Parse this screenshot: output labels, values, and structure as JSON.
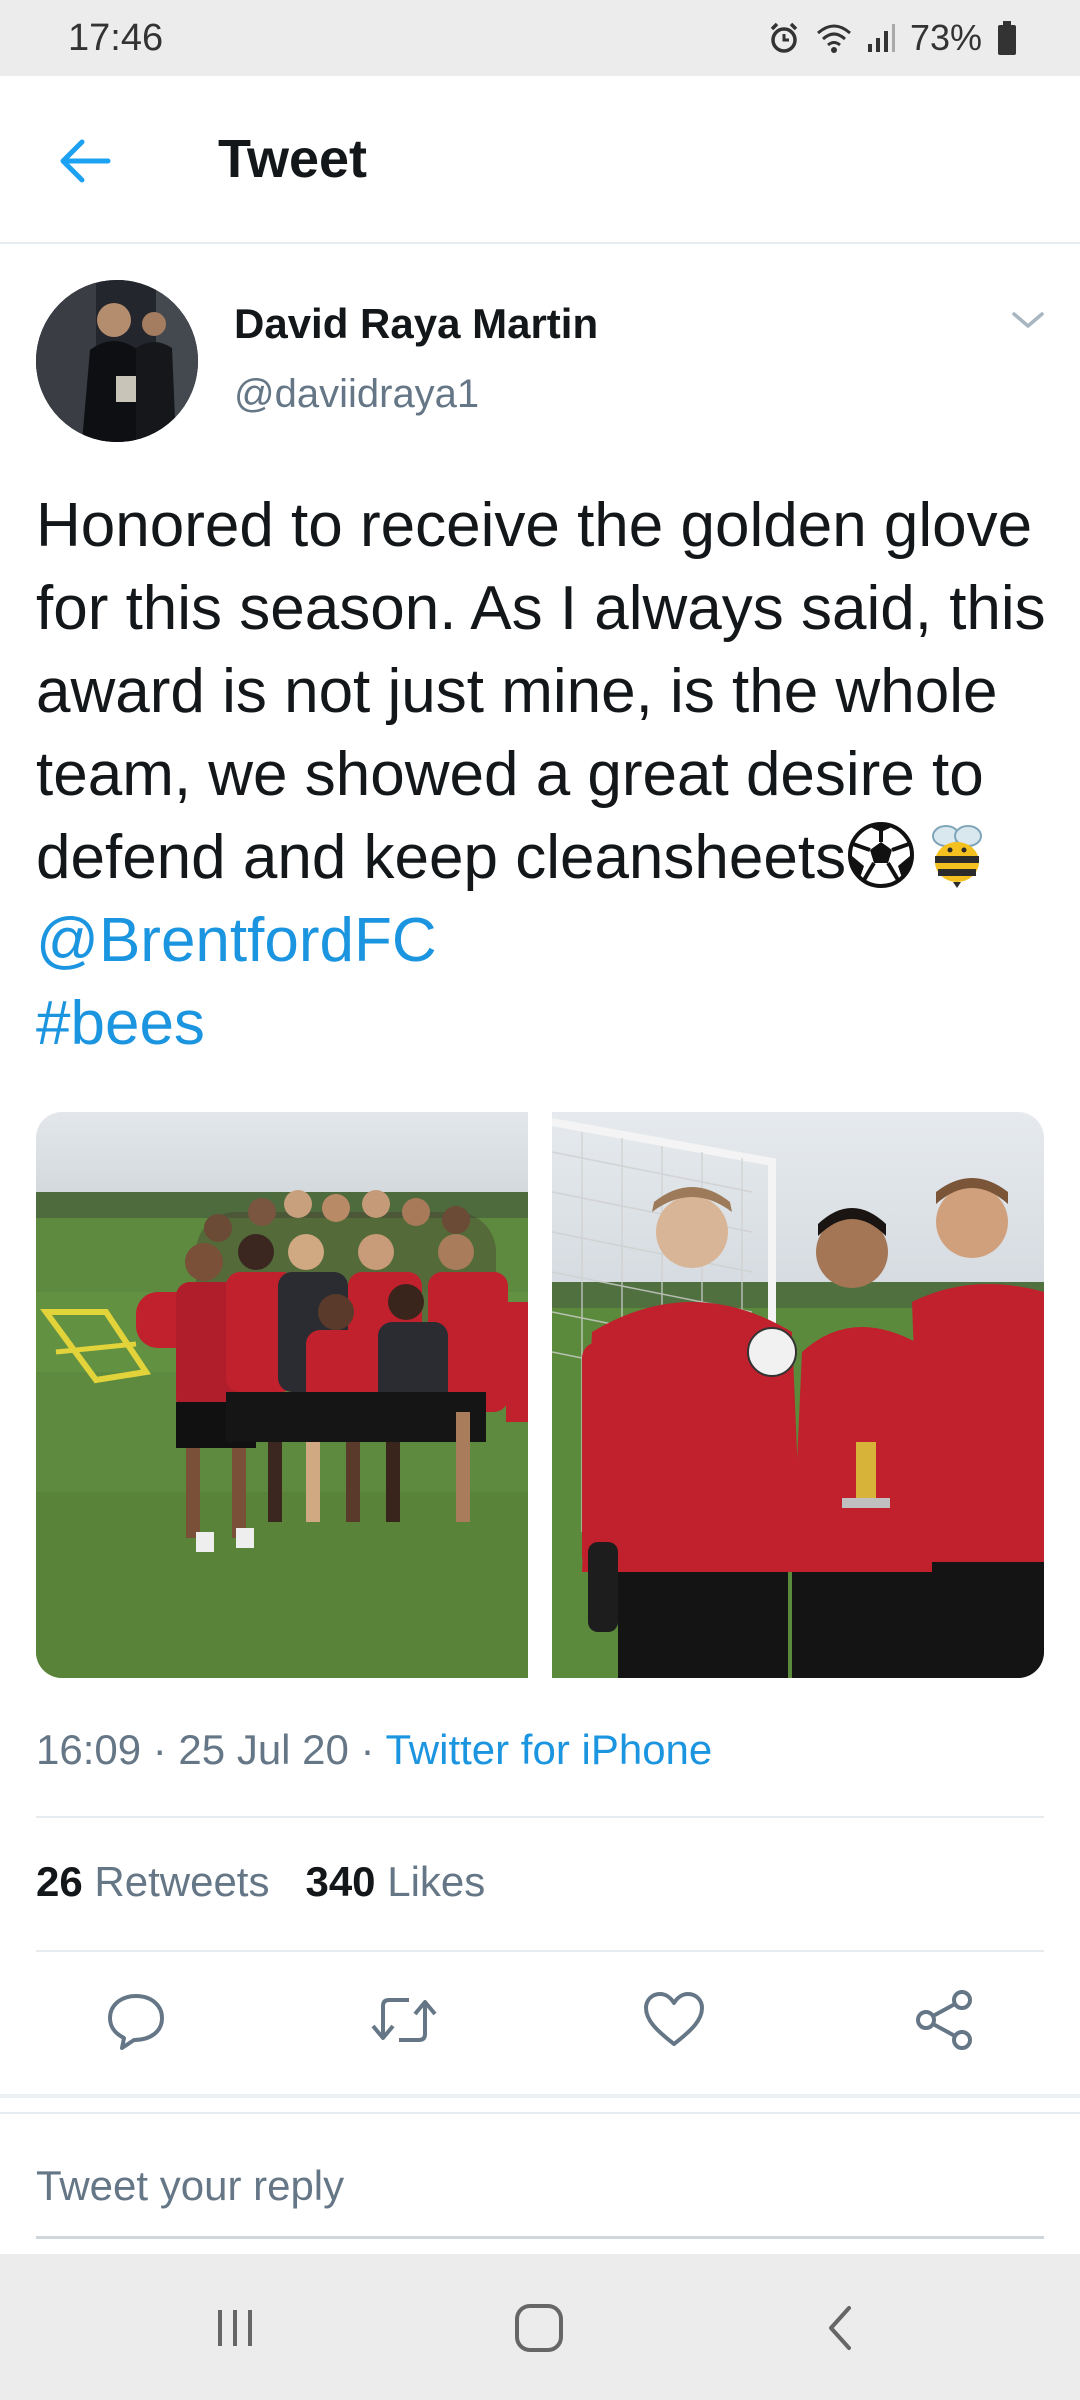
{
  "status_bar": {
    "time": "17:46",
    "battery": "73%",
    "icons": [
      "alarm-icon",
      "wifi-icon",
      "signal-icon",
      "battery-icon"
    ]
  },
  "header": {
    "title": "Tweet",
    "back_icon": "arrow-left-icon",
    "accent_color": "#1da1f2"
  },
  "tweet": {
    "author_name": "David Raya Martin",
    "author_handle": "@daviidraya1",
    "text": "Honored to receive the golden glove for this season. As I always said, this award is not just mine, is the whole team, we showed a great desire to defend and keep cleansheets",
    "emojis": [
      "soccer-ball-emoji",
      "bee-emoji"
    ],
    "mention": "@BrentfordFC",
    "hashtag": "#bees",
    "timestamp": "16:09 · 25 Jul 20 · ",
    "source": "Twitter for iPhone",
    "link_color": "#1b95e0"
  },
  "stats": {
    "retweets_count": "26",
    "retweets_label": "Retweets",
    "likes_count": "340",
    "likes_label": "Likes"
  },
  "actions": [
    "reply-icon",
    "retweet-icon",
    "like-icon",
    "share-icon"
  ],
  "reply": {
    "placeholder": "Tweet your reply"
  },
  "nav_bar": [
    "recent-apps-icon",
    "home-icon",
    "back-icon"
  ]
}
